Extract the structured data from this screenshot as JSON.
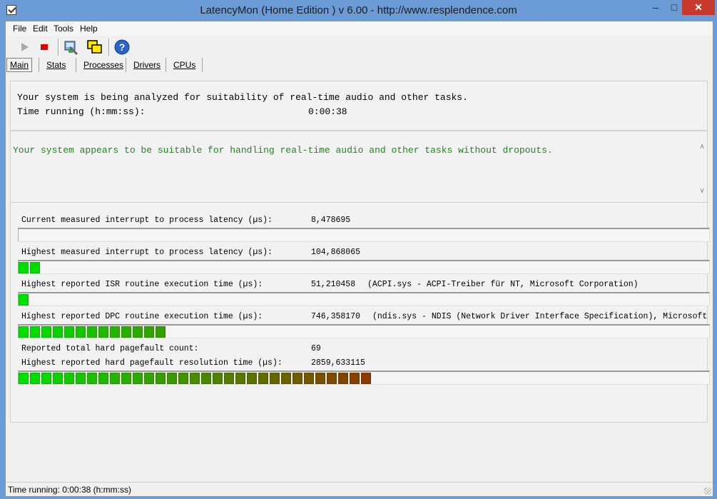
{
  "window": {
    "title": "LatencyMon  (Home Edition )  v 6.00 - http://www.resplendence.com",
    "min_glyph": "–",
    "max_glyph": "□",
    "close_glyph": "✕"
  },
  "menu": [
    "File",
    "Edit",
    "Tools",
    "Help"
  ],
  "toolbar": [
    {
      "name": "start-button",
      "icon": "play-icon"
    },
    {
      "name": "stop-button",
      "icon": "stop-icon"
    },
    {
      "name": "analyze-button",
      "icon": "wrench-icon"
    },
    {
      "name": "windows-button",
      "icon": "windows-icon"
    },
    {
      "name": "help-button",
      "icon": "help-icon"
    }
  ],
  "tabs": [
    "Main",
    "Stats",
    "Processes",
    "Drivers",
    "CPUs"
  ],
  "status_panel": {
    "line1": "Your system is being analyzed for suitability of real-time audio and other tasks.",
    "time_label": "Time running (h:mm:ss):",
    "time_value": "0:00:38"
  },
  "verdict": "Your system appears to be suitable for handling real-time audio and other tasks without dropouts.",
  "metrics": [
    {
      "label": "Current measured interrupt to process latency (µs):",
      "value": "8,478695",
      "extra": "",
      "segments": 0
    },
    {
      "label": "Highest measured interrupt to process latency (µs):",
      "value": "104,868065",
      "extra": "",
      "segments": 2
    },
    {
      "label": "Highest reported ISR routine execution time (µs):",
      "value": "51,210458",
      "extra": "(ACPI.sys - ACPI-Treiber für NT, Microsoft Corporation)",
      "segments": 1
    },
    {
      "label": "Highest reported DPC routine execution time (µs):",
      "value": "746,358170",
      "extra": "(ndis.sys - NDIS (Network Driver Interface Specification), Microsoft",
      "segments": 13
    },
    {
      "label": "Reported total hard pagefault count:",
      "value": "69",
      "extra": "",
      "segments": null
    },
    {
      "label": "Highest reported hard pagefault resolution time (µs):",
      "value": "2859,633115",
      "extra": "",
      "segments": 31
    }
  ],
  "statusbar": "Time running: 0:00:38  (h:mm:ss)",
  "colors": {
    "bar_start": "#00e000",
    "bar_end": "#8b3a00",
    "verdict": "#1a8a1a"
  }
}
